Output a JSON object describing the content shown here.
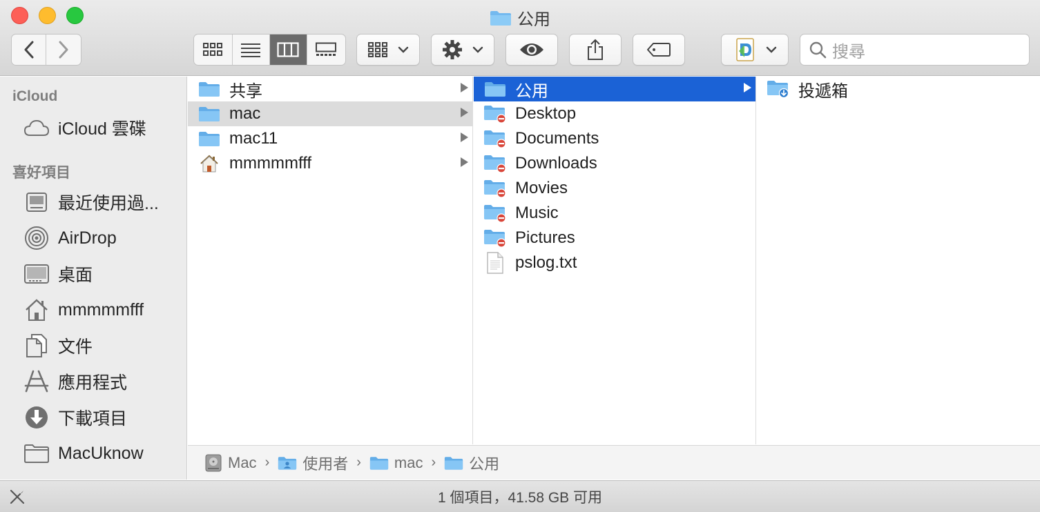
{
  "window": {
    "title": "公用"
  },
  "toolbar": {
    "back_icon": "chevron-left-icon",
    "forward_icon": "chevron-right-icon",
    "views": [
      "icon-view",
      "list-view",
      "column-view",
      "gallery-view"
    ],
    "active_view": "column-view",
    "group_icon": "group-grid-icon",
    "action_icon": "gear-icon",
    "quicklook_icon": "eye-icon",
    "share_icon": "share-icon",
    "tag_icon": "tag-icon",
    "app_icon": "dictionary-app-icon",
    "search": {
      "placeholder": "搜尋"
    }
  },
  "sidebar": {
    "sections": [
      {
        "heading": "iCloud",
        "items": [
          {
            "label": "iCloud 雲碟",
            "icon": "cloud-icon"
          }
        ]
      },
      {
        "heading": "喜好項目",
        "items": [
          {
            "label": "最近使用過...",
            "icon": "recents-icon"
          },
          {
            "label": "AirDrop",
            "icon": "airdrop-icon"
          },
          {
            "label": "桌面",
            "icon": "desktop-icon"
          },
          {
            "label": "mmmmmfff",
            "icon": "home-icon"
          },
          {
            "label": "文件",
            "icon": "documents-icon"
          },
          {
            "label": "應用程式",
            "icon": "applications-icon"
          },
          {
            "label": "下載項目",
            "icon": "downloads-icon"
          },
          {
            "label": "MacUknow",
            "icon": "folder-icon"
          }
        ]
      }
    ]
  },
  "columns": [
    {
      "items": [
        {
          "name": "共享",
          "icon": "folder-icon",
          "has_children": true
        },
        {
          "name": "mac",
          "icon": "folder-icon",
          "has_children": true,
          "selected": "inactive"
        },
        {
          "name": "mac11",
          "icon": "folder-icon",
          "has_children": true
        },
        {
          "name": "mmmmmfff",
          "icon": "home-icon",
          "has_children": true
        }
      ]
    },
    {
      "items": [
        {
          "name": "公用",
          "icon": "folder-icon",
          "has_children": true,
          "selected": "active"
        },
        {
          "name": "Desktop",
          "icon": "restricted-folder-icon"
        },
        {
          "name": "Documents",
          "icon": "restricted-folder-icon"
        },
        {
          "name": "Downloads",
          "icon": "restricted-folder-icon"
        },
        {
          "name": "Movies",
          "icon": "restricted-folder-icon"
        },
        {
          "name": "Music",
          "icon": "restricted-folder-icon"
        },
        {
          "name": "Pictures",
          "icon": "restricted-folder-icon"
        },
        {
          "name": "pslog.txt",
          "icon": "text-file-icon"
        }
      ]
    },
    {
      "items": [
        {
          "name": "投遞箱",
          "icon": "dropbox-folder-icon"
        }
      ]
    }
  ],
  "pathbar": {
    "items": [
      {
        "label": "Mac",
        "icon": "disk-icon"
      },
      {
        "label": "使用者",
        "icon": "users-folder-icon"
      },
      {
        "label": "mac",
        "icon": "folder-icon"
      },
      {
        "label": "公用",
        "icon": "folder-icon"
      }
    ],
    "separator": "›"
  },
  "status": {
    "text": "1 個項目，41.58 GB 可用"
  },
  "colors": {
    "selection_active": "#1b62d6",
    "selection_inactive": "#dcdcdc",
    "folder_blue": "#6cb4ec",
    "restricted_badge": "#d9463a"
  }
}
